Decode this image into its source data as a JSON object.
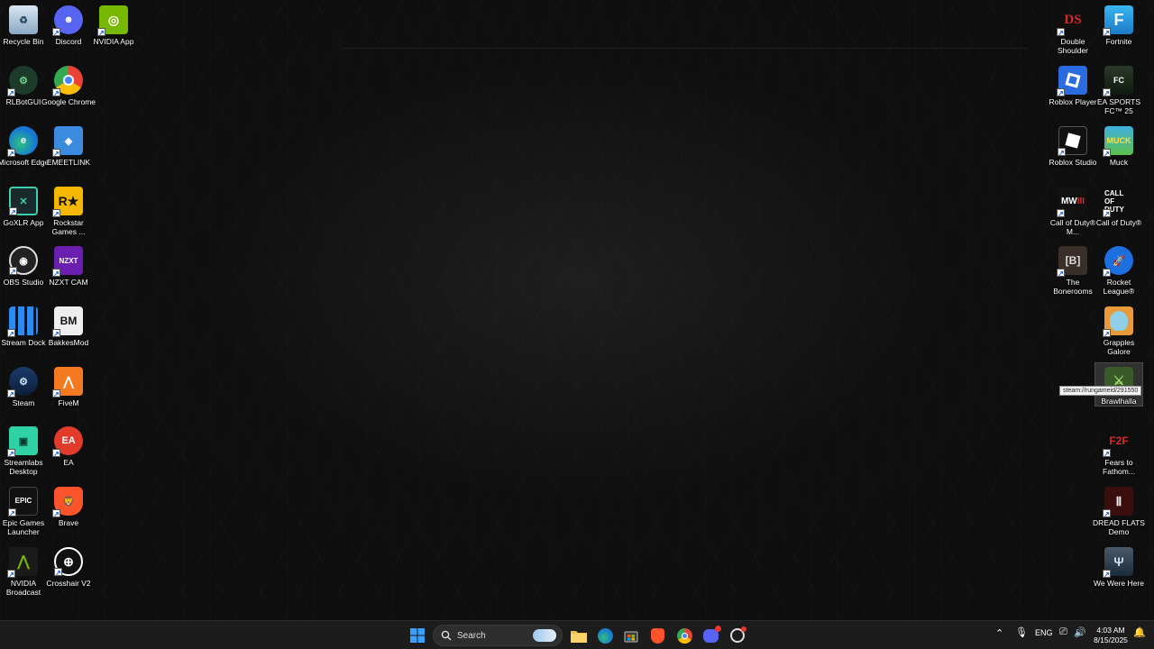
{
  "desktop": {
    "left_column_1": [
      {
        "label": "Recycle Bin",
        "icon": "recycle-bin-icon"
      },
      {
        "label": "RLBotGUI",
        "icon": "rlbot-icon"
      },
      {
        "label": "Microsoft Edge",
        "icon": "edge-icon"
      },
      {
        "label": "GoXLR App",
        "icon": "goxlr-icon"
      },
      {
        "label": "OBS Studio",
        "icon": "obs-icon"
      },
      {
        "label": "Stream Dock",
        "icon": "stream-dock-icon"
      },
      {
        "label": "Steam",
        "icon": "steam-icon"
      },
      {
        "label": "Streamlabs Desktop",
        "icon": "streamlabs-icon"
      },
      {
        "label": "Epic Games Launcher",
        "icon": "epic-games-icon"
      },
      {
        "label": "NVIDIA Broadcast",
        "icon": "nvidia-broadcast-icon"
      }
    ],
    "left_column_2": [
      {
        "label": "Discord",
        "icon": "discord-icon"
      },
      {
        "label": "Google Chrome",
        "icon": "chrome-icon"
      },
      {
        "label": "EMEETLINK",
        "icon": "emeetlink-icon"
      },
      {
        "label": "Rockstar Games ...",
        "icon": "rockstar-icon"
      },
      {
        "label": "NZXT CAM",
        "icon": "nzxt-icon"
      },
      {
        "label": "BakkesMod",
        "icon": "bakkesmod-icon"
      },
      {
        "label": "FiveM",
        "icon": "fivem-icon"
      },
      {
        "label": "EA",
        "icon": "ea-icon"
      },
      {
        "label": "Brave",
        "icon": "brave-icon"
      },
      {
        "label": "Crosshair V2",
        "icon": "crosshair-icon"
      }
    ],
    "left_column_3": [
      {
        "label": "NVIDIA App",
        "icon": "nvidia-icon"
      }
    ],
    "right_column_1": [
      {
        "label": "Double Shoulder",
        "icon": "double-shoulder-icon"
      },
      {
        "label": "Roblox Player",
        "icon": "roblox-player-icon"
      },
      {
        "label": "Roblox Studio",
        "icon": "roblox-studio-icon"
      },
      {
        "label": "Call of Duty® M...",
        "icon": "mw3-icon"
      },
      {
        "label": "The Bonerooms",
        "icon": "bonerooms-icon"
      }
    ],
    "right_column_2": [
      {
        "label": "Fortnite",
        "icon": "fortnite-icon"
      },
      {
        "label": "EA SPORTS FC™ 25",
        "icon": "ea-fc-icon"
      },
      {
        "label": "Muck",
        "icon": "muck-icon"
      },
      {
        "label": "Call of Duty®",
        "icon": "call-of-duty-icon"
      },
      {
        "label": "Rocket League®",
        "icon": "rocket-league-icon"
      },
      {
        "label": "Grapples Galore",
        "icon": "grapples-icon"
      },
      {
        "label": "Brawlhalla",
        "icon": "brawlhalla-icon"
      },
      {
        "label": "Fears to Fathom...",
        "icon": "fears-icon"
      },
      {
        "label": "DREAD FLATS Demo",
        "icon": "dread-flats-icon"
      },
      {
        "label": "We Were Here",
        "icon": "we-were-here-icon"
      }
    ],
    "tooltip": "steam://rungameid/291550"
  },
  "taskbar": {
    "search_label": "Search",
    "language": "ENG",
    "time": "4:03 AM",
    "date": "8/15/2025"
  },
  "colors": {
    "taskbar_bg": "#1c1c1c",
    "accent": "#1a5fd0"
  }
}
